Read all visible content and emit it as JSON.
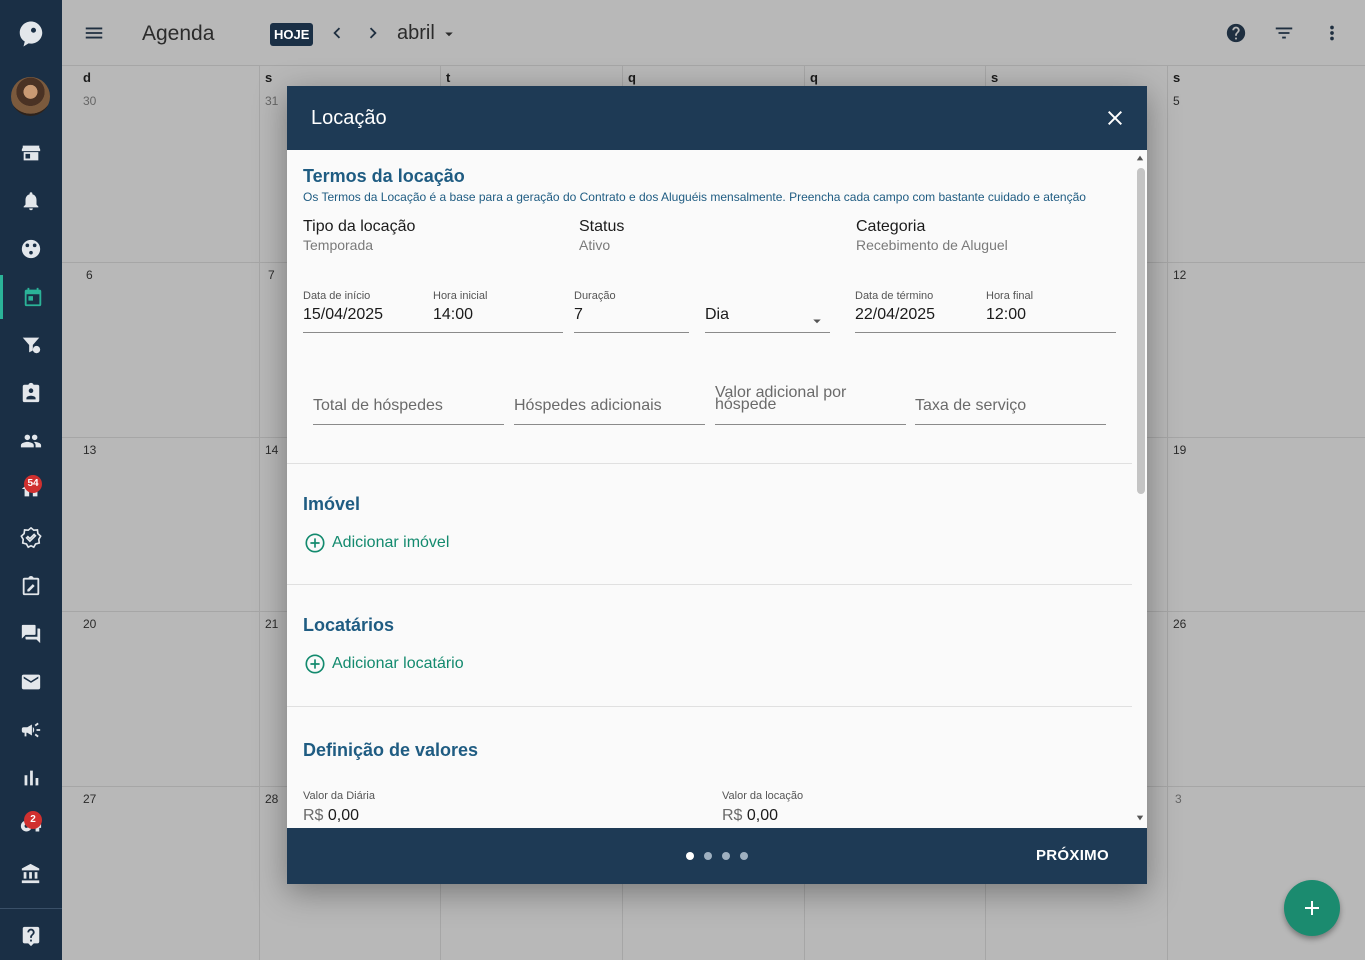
{
  "topbar": {
    "title": "Agenda",
    "today_label": "HOJE",
    "month": "abril"
  },
  "sidebar": {
    "notifications_badge": "54",
    "keys_badge": "2"
  },
  "calendar": {
    "weekdays": [
      "d",
      "s",
      "t",
      "q",
      "q",
      "s",
      "s"
    ],
    "weeks": [
      [
        "30",
        "31",
        "",
        "",
        "",
        "",
        "5"
      ],
      [
        "6",
        "7",
        "",
        "",
        "",
        "",
        "12"
      ],
      [
        "13",
        "14",
        "",
        "",
        "",
        "",
        "19"
      ],
      [
        "20",
        "21",
        "",
        "",
        "",
        "",
        "26"
      ],
      [
        "27",
        "28",
        "",
        "",
        "",
        "",
        "3"
      ]
    ]
  },
  "modal": {
    "title": "Locação",
    "terms": {
      "title": "Termos da locação",
      "subtitle": "Os Termos da Locação é a base para a geração do Contrato e dos Aluguéis mensalmente. Preencha cada campo com bastante cuidado e atenção",
      "tipo_label": "Tipo da locação",
      "tipo_value": "Temporada",
      "status_label": "Status",
      "status_value": "Ativo",
      "categoria_label": "Categoria",
      "categoria_value": "Recebimento de Aluguel"
    },
    "dates": {
      "data_inicio_label": "Data de início",
      "data_inicio_value": "15/04/2025",
      "hora_inicial_label": "Hora inicial",
      "hora_inicial_value": "14:00",
      "duracao_label": "Duração",
      "duracao_value": "7",
      "unidade_value": "Dia",
      "data_termino_label": "Data de término",
      "data_termino_value": "22/04/2025",
      "hora_final_label": "Hora final",
      "hora_final_value": "12:00"
    },
    "guests": {
      "total_placeholder": "Total de hóspedes",
      "adicionais_placeholder": "Hóspedes adicionais",
      "valor_adicional_placeholder": "Valor adicional por hóspede",
      "taxa_placeholder": "Taxa de serviço"
    },
    "imovel": {
      "title": "Imóvel",
      "add_label": "Adicionar imóvel"
    },
    "locatarios": {
      "title": "Locatários",
      "add_label": "Adicionar locatário"
    },
    "valores": {
      "title": "Definição de valores",
      "diaria_label": "Valor da Diária",
      "diaria_currency": "R$",
      "diaria_value": "0,00",
      "locacao_label": "Valor da locação",
      "locacao_currency": "R$",
      "locacao_value": "0,00"
    },
    "footer": {
      "next_label": "PRÓXIMO",
      "steps": 4,
      "current_step": 1
    }
  }
}
